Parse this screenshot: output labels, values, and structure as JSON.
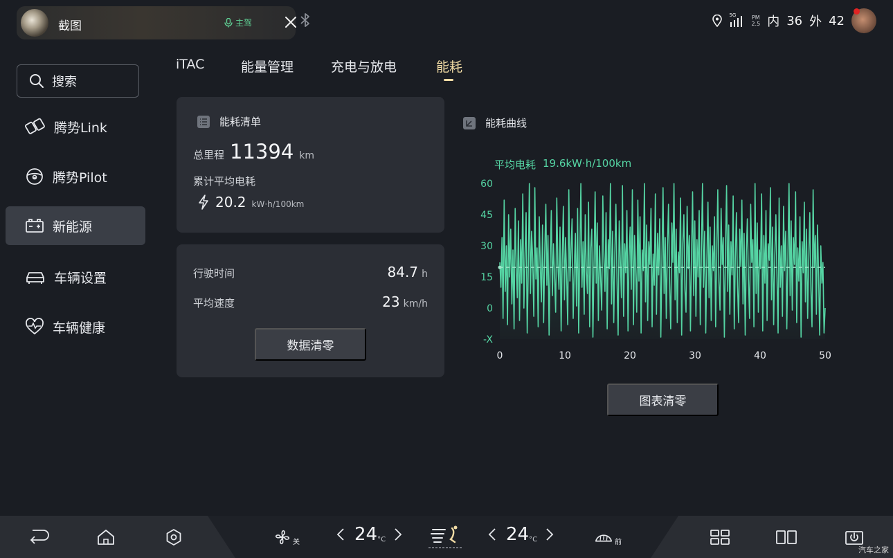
{
  "status_bar": {
    "media_title": "截图",
    "driver_badge": "主驾",
    "network": "5G",
    "pm_label": "PM",
    "pm_value": "2.5",
    "inside_label": "内",
    "inside_value": "36",
    "outside_label": "外",
    "outside_value": "42"
  },
  "sidebar": {
    "search_label": "搜索",
    "items": [
      {
        "label": "腾势Link",
        "icon": "link-icon"
      },
      {
        "label": "腾势Pilot",
        "icon": "steering-wheel-icon"
      },
      {
        "label": "新能源",
        "icon": "battery-icon",
        "active": true
      },
      {
        "label": "车辆设置",
        "icon": "car-icon"
      },
      {
        "label": "车辆健康",
        "icon": "heart-pulse-icon"
      }
    ]
  },
  "tabs": [
    {
      "label": "iTAC"
    },
    {
      "label": "能量管理"
    },
    {
      "label": "充电与放电"
    },
    {
      "label": "能耗",
      "active": true
    }
  ],
  "consumption_list": {
    "title": "能耗清单",
    "total_mileage_label": "总里程",
    "total_mileage_value": "11394",
    "total_mileage_unit": "km",
    "avg_consumption_label": "累计平均电耗",
    "avg_consumption_value": "20.2",
    "avg_consumption_unit": "kW·h/100km"
  },
  "trip_stats": {
    "drive_time_label": "行驶时间",
    "drive_time_value": "84.7",
    "drive_time_unit": "h",
    "avg_speed_label": "平均速度",
    "avg_speed_value": "23",
    "avg_speed_unit": "km/h",
    "reset_button": "数据清零"
  },
  "chart_panel": {
    "title": "能耗曲线",
    "avg_label": "平均电耗",
    "avg_value": "19.6kW·h/100km",
    "reset_button": "图表清零"
  },
  "chart_data": {
    "type": "line",
    "title": "",
    "xlabel": "",
    "ylabel": "",
    "xlim": [
      0,
      50
    ],
    "ylim": [
      -15,
      60
    ],
    "x_ticks": [
      "0",
      "10",
      "20",
      "30",
      "40",
      "50"
    ],
    "y_ticks": [
      {
        "value": 60,
        "label": "60"
      },
      {
        "value": 45,
        "label": "45"
      },
      {
        "value": 30,
        "label": "30"
      },
      {
        "value": 15,
        "label": "15"
      },
      {
        "value": 0,
        "label": "0"
      },
      {
        "value": -15,
        "label": "-X"
      }
    ],
    "average": 19.6,
    "line_color": "#55d4a3",
    "series": [
      {
        "values": [
          22,
          10,
          34,
          -5,
          52,
          8,
          30,
          -8,
          45,
          15,
          38,
          2,
          28,
          -10,
          48,
          20,
          5,
          42,
          -6,
          33,
          12,
          55,
          0,
          26,
          46,
          -12,
          18,
          60,
          7,
          37,
          24,
          -4,
          58,
          14,
          29,
          -9,
          44,
          19,
          3,
          40,
          -7,
          27,
          50,
          11,
          35,
          -13,
          23,
          47,
          6,
          31,
          16,
          -2,
          53,
          21,
          9,
          39,
          -11,
          25,
          49,
          4,
          34,
          17,
          -8,
          57,
          13,
          28,
          43,
          -5,
          20,
          36,
          1,
          48,
          -12,
          24,
          60,
          10,
          32,
          -3,
          45,
          18,
          7,
          51,
          -9,
          29,
          38,
          -14,
          22,
          56,
          12,
          41,
          -6,
          30,
          15,
          -1,
          54,
          26,
          8,
          46,
          -10,
          33,
          19,
          60,
          2,
          37,
          -7,
          27,
          50,
          14,
          -13,
          42,
          23,
          5,
          59,
          -4,
          31,
          17,
          47,
          -11,
          25,
          39,
          9,
          57,
          -8,
          35,
          20,
          -2,
          52,
          13,
          44,
          -12,
          28,
          18,
          60,
          3,
          40,
          -6,
          32,
          21,
          48,
          -9,
          26,
          11,
          55,
          -3,
          36,
          16,
          43,
          -14,
          24,
          58,
          7,
          34,
          -5,
          29,
          50,
          12,
          -10,
          41,
          22,
          60,
          4,
          38,
          -7,
          27,
          17,
          53,
          -13,
          31,
          45,
          9,
          -2,
          49,
          19,
          35,
          -11,
          25,
          56,
          6,
          42,
          -4,
          33,
          15,
          47,
          -8,
          28,
          60,
          10,
          37,
          -12,
          23,
          51,
          5,
          39,
          -6,
          30,
          18,
          44,
          -9,
          26,
          57,
          13,
          -1,
          48,
          21,
          34,
          -14,
          29,
          59,
          8,
          40,
          -3,
          32,
          16,
          54,
          -10,
          24,
          46,
          11,
          -7,
          38,
          20,
          52,
          2,
          36,
          -13,
          27,
          43,
          14,
          -5,
          50,
          22,
          33,
          -9,
          60,
          7,
          41,
          -2,
          28,
          19,
          55,
          -11,
          35,
          12,
          47,
          -6,
          31,
          23,
          58,
          4,
          39,
          -8,
          25,
          45,
          15,
          -12,
          53,
          10,
          30,
          -4,
          49,
          18,
          37,
          -10,
          26,
          60,
          6,
          42,
          -1,
          34,
          21,
          56,
          -7,
          29,
          13,
          44,
          -14,
          32,
          17,
          51,
          3,
          38,
          -5,
          24,
          46,
          9,
          -9,
          57,
          20,
          35,
          -3,
          40,
          16,
          -13,
          30,
          12,
          22,
          -12,
          0
        ]
      }
    ]
  },
  "dock": {
    "fan_label": "关",
    "left_temp": "24",
    "right_temp": "24",
    "temp_unit": "°C",
    "defrost_label": "前",
    "watermark": "汽车之家"
  }
}
